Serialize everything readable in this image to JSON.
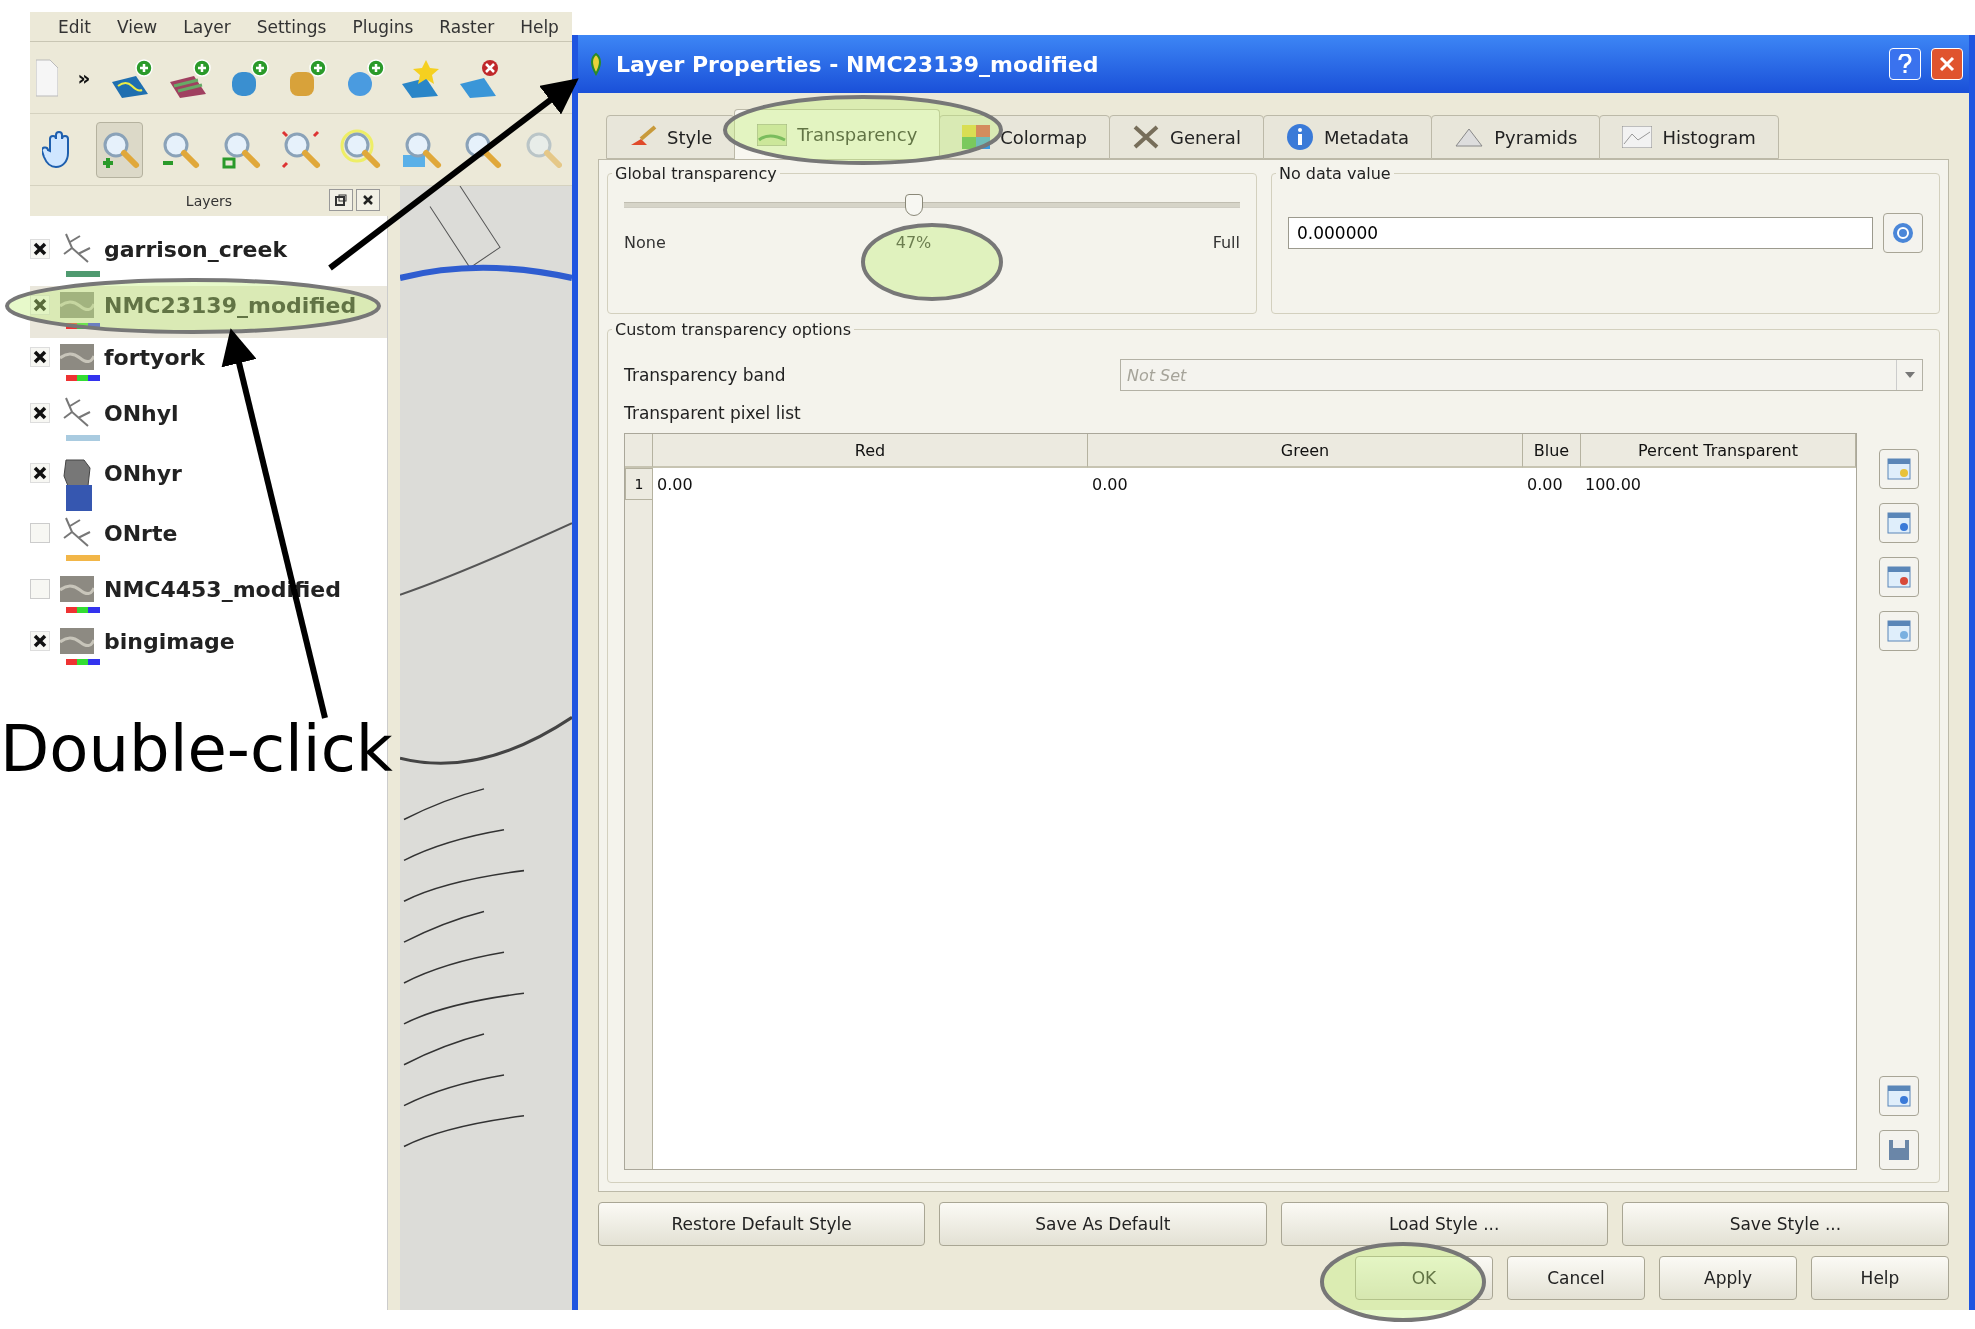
{
  "menu": [
    "Edit",
    "View",
    "Layer",
    "Settings",
    "Plugins",
    "Raster",
    "Help"
  ],
  "toolbar": {
    "overflow": "»"
  },
  "map_tools": [
    {
      "kind": "pan",
      "selected": false
    },
    {
      "kind": "zoom-in",
      "selected": true
    },
    {
      "kind": "zoom-out",
      "selected": false
    },
    {
      "kind": "zoom-selection",
      "selected": false
    },
    {
      "kind": "zoom-full",
      "selected": false
    },
    {
      "kind": "zoom-layer",
      "selected": false
    },
    {
      "kind": "zoom-native",
      "selected": false
    },
    {
      "kind": "zoom-last",
      "selected": false
    },
    {
      "kind": "zoom-next",
      "selected": false
    }
  ],
  "layers_panel": {
    "title": "Layers",
    "layers": [
      {
        "name": "garrison_creek",
        "kind": "line",
        "checked": true,
        "selected": false,
        "color": "#4f9a70"
      },
      {
        "name": "NMC23139_modified",
        "kind": "raster",
        "checked": true,
        "selected": true
      },
      {
        "name": "fortyork",
        "kind": "raster",
        "checked": true,
        "selected": false
      },
      {
        "name": "ONhyl",
        "kind": "line",
        "checked": true,
        "selected": false,
        "color": "#a9cbe0"
      },
      {
        "name": "ONhyr",
        "kind": "polygon",
        "checked": true,
        "selected": false,
        "color": "#3657b0"
      },
      {
        "name": "ONrte",
        "kind": "line",
        "checked": false,
        "selected": false,
        "color": "#f2b648"
      },
      {
        "name": "NMC4453_modified",
        "kind": "raster",
        "checked": false,
        "selected": false
      },
      {
        "name": "bingimage",
        "kind": "raster",
        "checked": true,
        "selected": false
      }
    ]
  },
  "dialog": {
    "title": "Layer Properties - NMC23139_modified",
    "tabs": [
      {
        "label": "Style",
        "kind": "style",
        "selected": false
      },
      {
        "label": "Transparency",
        "kind": "transparency",
        "selected": true
      },
      {
        "label": "Colormap",
        "kind": "colormap",
        "selected": false
      },
      {
        "label": "General",
        "kind": "general",
        "selected": false
      },
      {
        "label": "Metadata",
        "kind": "metadata",
        "selected": false
      },
      {
        "label": "Pyramids",
        "kind": "pyramids",
        "selected": false
      },
      {
        "label": "Histogram",
        "kind": "histogram",
        "selected": false
      }
    ],
    "global_transparency": {
      "title": "Global transparency",
      "level": 0.47,
      "min_label": "None",
      "value": "47%",
      "max_label": "Full"
    },
    "no_data": {
      "title": "No data value",
      "value": "0.000000"
    },
    "custom": {
      "title": "Custom transparency options",
      "band_label": "Transparency band",
      "band_value": "Not Set",
      "band_disabled": true,
      "list_label": "Transparent pixel list",
      "columns": [
        "Red",
        "Green",
        "Blue",
        "Percent Transparent"
      ],
      "rows": [
        {
          "index": "1",
          "cells": [
            "0.00",
            "0.00",
            "0.00",
            "100.00"
          ]
        }
      ]
    },
    "style_buttons": [
      "Restore Default Style",
      "Save As Default",
      "Load Style ...",
      "Save Style ..."
    ],
    "buttons": [
      "OK",
      "Cancel",
      "Apply",
      "Help"
    ]
  },
  "annotation": {
    "callout": "Double-click"
  }
}
